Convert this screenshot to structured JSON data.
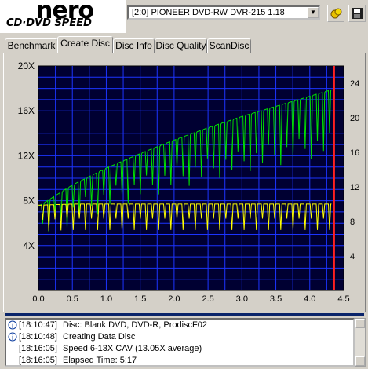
{
  "header": {
    "logo_brand": "nero",
    "logo_product": "CD·DVD SPEED",
    "drive_select": "[2:0]  PIONEER DVD-RW  DVR-215 1.18"
  },
  "tabs": [
    {
      "label": "Benchmark"
    },
    {
      "label": "Create Disc",
      "active": true
    },
    {
      "label": "Disc Info"
    },
    {
      "label": "Disc Quality"
    },
    {
      "label": "ScanDisc"
    }
  ],
  "chart_data": {
    "type": "line",
    "xlim": [
      0,
      4.5
    ],
    "ylim_left": [
      0,
      20
    ],
    "ylim_right": [
      0,
      26
    ],
    "x_ticks": [
      "0.0",
      "0.5",
      "1.0",
      "1.5",
      "2.0",
      "2.5",
      "3.0",
      "3.5",
      "4.0",
      "4.5"
    ],
    "y_left_ticks": [
      "4X",
      "8X",
      "12X",
      "16X",
      "20X"
    ],
    "y_right_ticks": [
      "4",
      "8",
      "12",
      "16",
      "20",
      "24"
    ],
    "grid": true,
    "end_marker_x": 4.36,
    "series": [
      {
        "color": "#00e000",
        "axis": "left",
        "x": [
          0.0,
          0.5,
          1.0,
          1.5,
          2.0,
          2.5,
          3.0,
          3.5,
          4.0,
          4.33
        ],
        "values": [
          7.5,
          9.4,
          10.9,
          12.2,
          13.4,
          14.5,
          15.5,
          16.4,
          17.3,
          17.9
        ]
      },
      {
        "color": "#ffff00",
        "axis": "left",
        "x": [
          0.0,
          0.5,
          1.0,
          1.5,
          2.0,
          2.5,
          3.0,
          3.5,
          4.0,
          4.33
        ],
        "values": [
          7.6,
          7.7,
          7.7,
          7.7,
          7.7,
          7.7,
          7.7,
          7.7,
          7.7,
          7.7
        ]
      }
    ],
    "colors": {
      "background": "#000032",
      "grid": "#1c34ff",
      "write_speed": "#00e000",
      "cpu": "#ffff00",
      "end_marker": "#ff2020"
    }
  },
  "log": [
    {
      "time": "[18:10:47]",
      "text": "Disc: Blank DVD, DVD-R, ProdiscF02",
      "icon": "info-icon"
    },
    {
      "time": "[18:10:48]",
      "text": "Creating Data Disc",
      "icon": "info-icon"
    },
    {
      "time": "[18:16:05]",
      "text": "Speed 6-13X CAV (13.05X average)",
      "icon": ""
    },
    {
      "time": "[18:16:05]",
      "text": "Elapsed Time:  5:17",
      "icon": ""
    }
  ]
}
